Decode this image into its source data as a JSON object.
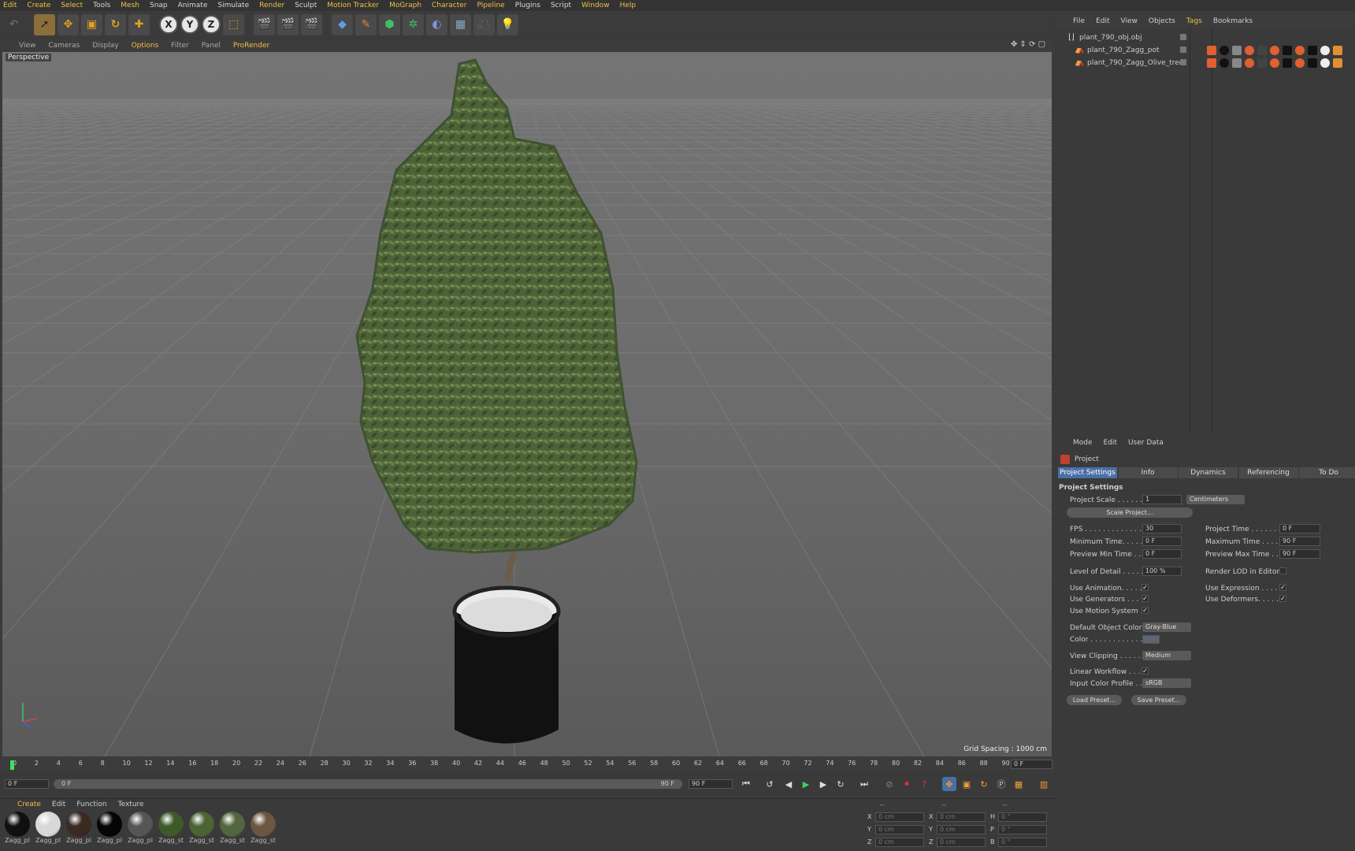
{
  "menu": [
    "Edit",
    "Create",
    "Select",
    "Tools",
    "Mesh",
    "Snap",
    "Animate",
    "Simulate",
    "Render",
    "Sculpt",
    "Motion Tracker",
    "MoGraph",
    "Character",
    "Pipeline",
    "Plugins",
    "Script",
    "Window",
    "Help"
  ],
  "toolbar": {
    "axis_x": "X",
    "axis_y": "Y",
    "axis_z": "Z"
  },
  "viewport_menu": [
    "View",
    "Cameras",
    "Display",
    "Options",
    "Filter",
    "Panel",
    "ProRender"
  ],
  "viewport": {
    "label": "Perspective",
    "grid_spacing": "Grid Spacing : 1000 cm"
  },
  "timeline": {
    "ticks": [
      "0",
      "2",
      "4",
      "6",
      "8",
      "10",
      "12",
      "14",
      "16",
      "18",
      "20",
      "22",
      "24",
      "26",
      "28",
      "30",
      "32",
      "34",
      "36",
      "38",
      "40",
      "42",
      "44",
      "46",
      "48",
      "50",
      "52",
      "54",
      "56",
      "58",
      "60",
      "62",
      "64",
      "66",
      "68",
      "70",
      "72",
      "74",
      "76",
      "78",
      "80",
      "82",
      "84",
      "86",
      "88",
      "90"
    ],
    "current_frame": "0 F"
  },
  "transport": {
    "start": "0 F",
    "range_start": "0 F",
    "range_end": "90 F",
    "end": "90 F"
  },
  "material_menu": [
    "Create",
    "Edit",
    "Function",
    "Texture"
  ],
  "materials": [
    {
      "label": "Zagg_pl",
      "color": "#101010"
    },
    {
      "label": "Zagg_pl",
      "color": "#d8d8d8"
    },
    {
      "label": "Zagg_pl",
      "color": "#3a2a22"
    },
    {
      "label": "Zagg_pl",
      "color": "#050505"
    },
    {
      "label": "Zagg_pl",
      "color": "#555555"
    },
    {
      "label": "Zagg_st",
      "color": "#3f5a2a"
    },
    {
      "label": "Zagg_st",
      "color": "#4a6433"
    },
    {
      "label": "Zagg_st",
      "color": "#52663f"
    },
    {
      "label": "Zagg_st",
      "color": "#6b5640"
    }
  ],
  "coords": {
    "header": [
      "--",
      "--",
      "--"
    ],
    "rows": [
      {
        "a": "X",
        "av": "0 cm",
        "b": "X",
        "bv": "0 cm",
        "c": "H",
        "cv": "0 °"
      },
      {
        "a": "Y",
        "av": "0 cm",
        "b": "Y",
        "bv": "0 cm",
        "c": "P",
        "cv": "0 °"
      },
      {
        "a": "Z",
        "av": "0 cm",
        "b": "Z",
        "bv": "0 cm",
        "c": "B",
        "cv": "0 °"
      }
    ]
  },
  "object_manager": {
    "menu": [
      "File",
      "Edit",
      "View",
      "Objects",
      "Tags",
      "Bookmarks"
    ],
    "objects": [
      "plant_790_obj.obj",
      "plant_790_Zagg_pot",
      "plant_790_Zagg_Olive_tree"
    ]
  },
  "attributes": {
    "menu": [
      "Mode",
      "Edit",
      "User Data"
    ],
    "object": "Project",
    "tabs": [
      "Project Settings",
      "Info",
      "Dynamics",
      "Referencing",
      "To Do"
    ],
    "section": "Project Settings",
    "project_scale_label": "Project Scale . . . . . .",
    "project_scale_value": "1",
    "project_scale_unit": "Centimeters",
    "scale_project_button": "Scale Project...",
    "fps_label": "FPS . . . . . . . . . . . . . .",
    "fps_value": "30",
    "project_time_label": "Project Time . . . . . . . .",
    "project_time_value": "0 F",
    "min_time_label": "Minimum Time. . . . . .",
    "min_time_value": "0 F",
    "max_time_label": "Maximum Time . . . . . .",
    "max_time_value": "90 F",
    "preview_min_label": "Preview Min Time . . .",
    "preview_min_value": "0 F",
    "preview_max_label": "Preview Max Time . . .",
    "preview_max_value": "90 F",
    "lod_label": "Level of Detail . . . . .",
    "lod_value": "100 %",
    "render_lod_label": "Render LOD in Editor",
    "use_animation": "Use Animation. . . . .",
    "use_expression": "Use Expression . . . . .",
    "use_generators": "Use Generators . . . .",
    "use_deformers": "Use Deformers. . . . . .",
    "use_motion": "Use Motion System",
    "default_color_label": "Default Object Color",
    "default_color_value": "Gray-Blue",
    "color_label": "Color . . . . . . . . . . . .",
    "view_clipping_label": "View Clipping . . . . .",
    "view_clipping_value": "Medium",
    "linear_workflow_label": "Linear Workflow . . .",
    "input_profile_label": "Input Color Profile . .",
    "input_profile_value": "sRGB",
    "load_preset": "Load Preset...",
    "save_preset": "Save Preset..."
  }
}
